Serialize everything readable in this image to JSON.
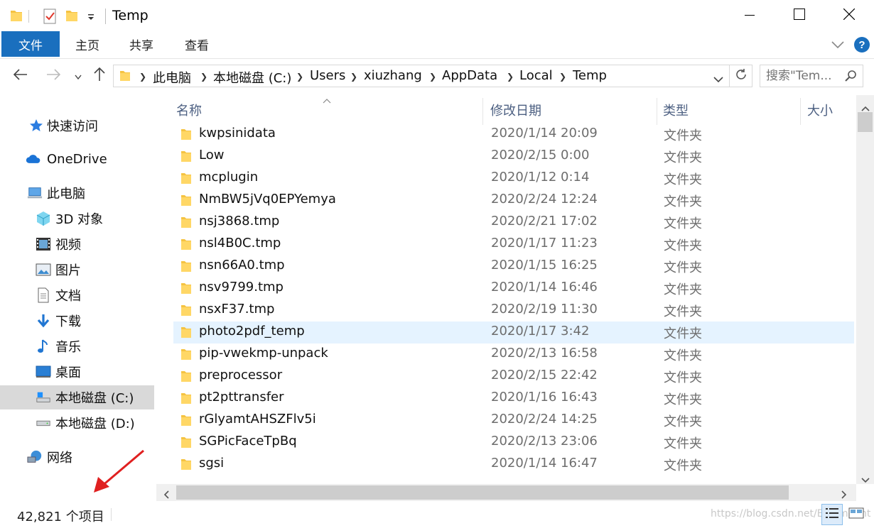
{
  "window": {
    "title": "Temp",
    "minimize_icon": "minimize-icon",
    "maximize_icon": "maximize-icon",
    "close_icon": "close-icon"
  },
  "quick_access_toolbar": {
    "icons": [
      "folder-icon",
      "properties-icon",
      "new-folder-icon",
      "customize-dropdown-icon"
    ]
  },
  "ribbon": {
    "tabs": [
      {
        "label": "文件",
        "active": true
      },
      {
        "label": "主页"
      },
      {
        "label": "共享"
      },
      {
        "label": "查看"
      }
    ],
    "expand_icon": "chevron-down-icon",
    "help_icon": "help-icon",
    "accent_color": "#1a6fbe"
  },
  "address_bar": {
    "breadcrumbs": [
      "此电脑",
      "本地磁盘 (C:)",
      "Users",
      "xiuzhang",
      "AppData",
      "Local",
      "Temp"
    ],
    "search_placeholder": "搜索\"Tem..."
  },
  "nav_pane": {
    "items": [
      {
        "label": "快速访问",
        "icon": "star-icon"
      },
      {
        "label": "OneDrive",
        "icon": "cloud-icon"
      },
      {
        "label": "此电脑",
        "icon": "computer-icon"
      },
      {
        "label": "3D 对象",
        "icon": "cube-3d-icon"
      },
      {
        "label": "视频",
        "icon": "video-icon"
      },
      {
        "label": "图片",
        "icon": "pictures-icon"
      },
      {
        "label": "文档",
        "icon": "document-icon"
      },
      {
        "label": "下载",
        "icon": "download-icon"
      },
      {
        "label": "音乐",
        "icon": "music-icon"
      },
      {
        "label": "桌面",
        "icon": "desktop-icon"
      },
      {
        "label": "本地磁盘 (C:)",
        "icon": "drive-c-icon",
        "selected": true
      },
      {
        "label": "本地磁盘 (D:)",
        "icon": "drive-icon"
      },
      {
        "label": "网络",
        "icon": "network-icon"
      }
    ]
  },
  "file_list": {
    "columns": [
      "名称",
      "修改日期",
      "类型",
      "大小"
    ],
    "rows": [
      {
        "name": "kwpsinidata",
        "date": "2020/1/14 20:09",
        "type": "文件夹"
      },
      {
        "name": "Low",
        "date": "2020/2/15 0:00",
        "type": "文件夹"
      },
      {
        "name": "mcplugin",
        "date": "2020/1/12 0:14",
        "type": "文件夹"
      },
      {
        "name": "NmBW5jVq0EPYemya",
        "date": "2020/2/24 12:24",
        "type": "文件夹"
      },
      {
        "name": "nsj3868.tmp",
        "date": "2020/2/21 17:02",
        "type": "文件夹"
      },
      {
        "name": "nsl4B0C.tmp",
        "date": "2020/1/17 11:23",
        "type": "文件夹"
      },
      {
        "name": "nsn66A0.tmp",
        "date": "2020/1/15 16:25",
        "type": "文件夹"
      },
      {
        "name": "nsv9799.tmp",
        "date": "2020/1/14 16:46",
        "type": "文件夹"
      },
      {
        "name": "nsxF37.tmp",
        "date": "2020/2/19 11:30",
        "type": "文件夹"
      },
      {
        "name": "photo2pdf_temp",
        "date": "2020/1/17 3:42",
        "type": "文件夹",
        "hover": true
      },
      {
        "name": "pip-vwekmp-unpack",
        "date": "2020/2/13 16:58",
        "type": "文件夹"
      },
      {
        "name": "preprocessor",
        "date": "2020/2/15 22:42",
        "type": "文件夹"
      },
      {
        "name": "pt2pttransfer",
        "date": "2020/1/16 16:43",
        "type": "文件夹"
      },
      {
        "name": "rGlyamtAHSZFlv5i",
        "date": "2020/2/24 14:25",
        "type": "文件夹"
      },
      {
        "name": "SGPicFaceTpBq",
        "date": "2020/2/13 23:06",
        "type": "文件夹"
      },
      {
        "name": "sgsi",
        "date": "2020/1/14 16:47",
        "type": "文件夹"
      }
    ]
  },
  "status_bar": {
    "item_count": "42,821 个项目",
    "watermark": "https://blog.csdn.net/Eastmount",
    "view_icons": [
      "details-view-icon",
      "large-icons-view-icon"
    ]
  },
  "annotation": {
    "arrow_icon": "red-arrow-icon",
    "color": "#e02020"
  }
}
